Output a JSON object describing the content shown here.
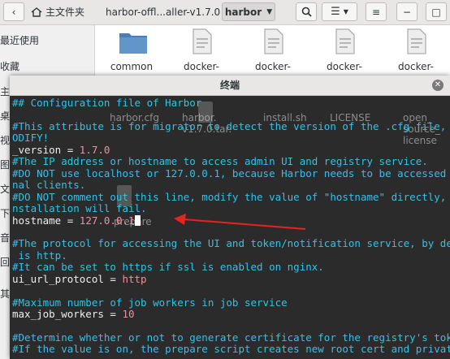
{
  "fm": {
    "home_label": "主文件夹",
    "crumb_prev": "harbor-offl...aller-v1.7.0",
    "crumb_current": "harbor"
  },
  "sidebar": {
    "items": [
      "最近使用",
      "收藏",
      "主目",
      "桌面",
      "视频",
      "图片",
      "文档",
      "下载",
      "音乐",
      "回收",
      "其他位置"
    ]
  },
  "files": {
    "row1": [
      "common",
      "docker-",
      "docker-",
      "docker-",
      "docker-"
    ]
  },
  "ghost_files": [
    "harbor.cfg",
    "harbor.\nv1.7.0.tar.",
    "install.sh",
    "LICENSE",
    "open_\nsource_\nlicense",
    "prepare"
  ],
  "terminal": {
    "title": "终端",
    "lines": [
      {
        "text": "## Configuration file of Harbor",
        "kind": "comment"
      },
      {
        "text": "",
        "kind": "comment"
      },
      {
        "text": "#This attribute is for migrator to detect the version of the .cfg file, DO N",
        "kind": "comment"
      },
      {
        "text": "ODIFY!",
        "kind": "comment"
      },
      {
        "text": "_version = ",
        "kind": "key",
        "value": "1.7.0"
      },
      {
        "text": "#The IP address or hostname to access admin UI and registry service.",
        "kind": "comment"
      },
      {
        "text": "#DO NOT use localhost or 127.0.0.1, because Harbor needs to be accessed by e",
        "kind": "comment"
      },
      {
        "text": "nal clients.",
        "kind": "comment"
      },
      {
        "text": "#DO NOT comment out this line, modify the value of \"hostname\" directly, or t",
        "kind": "comment"
      },
      {
        "text": "nstallation will fail.",
        "kind": "comment"
      },
      {
        "text": "hostname = ",
        "kind": "key",
        "value": "127.0.0.1"
      },
      {
        "text": "",
        "kind": "comment"
      },
      {
        "text": "#The protocol for accessing the UI and token/notification service, by defaul",
        "kind": "comment"
      },
      {
        "text": " is http.",
        "kind": "comment"
      },
      {
        "text": "#It can be set to https if ssl is enabled on nginx.",
        "kind": "comment"
      },
      {
        "text": "ui_url_protocol = ",
        "kind": "key",
        "value": "http"
      },
      {
        "text": "",
        "kind": "comment"
      },
      {
        "text": "#Maximum number of job workers in job service",
        "kind": "comment"
      },
      {
        "text": "max_job_workers = ",
        "kind": "key",
        "value": "10"
      },
      {
        "text": "",
        "kind": "comment"
      },
      {
        "text": "#Determine whether or not to generate certificate for the registry's token.",
        "kind": "comment"
      },
      {
        "text": "#If the value is on, the prepare script creates new root cert and private ke",
        "kind": "comment"
      }
    ]
  },
  "colors": {
    "comment": "#33c1e8",
    "value": "#f08fa0",
    "arrow": "#e8231f"
  }
}
